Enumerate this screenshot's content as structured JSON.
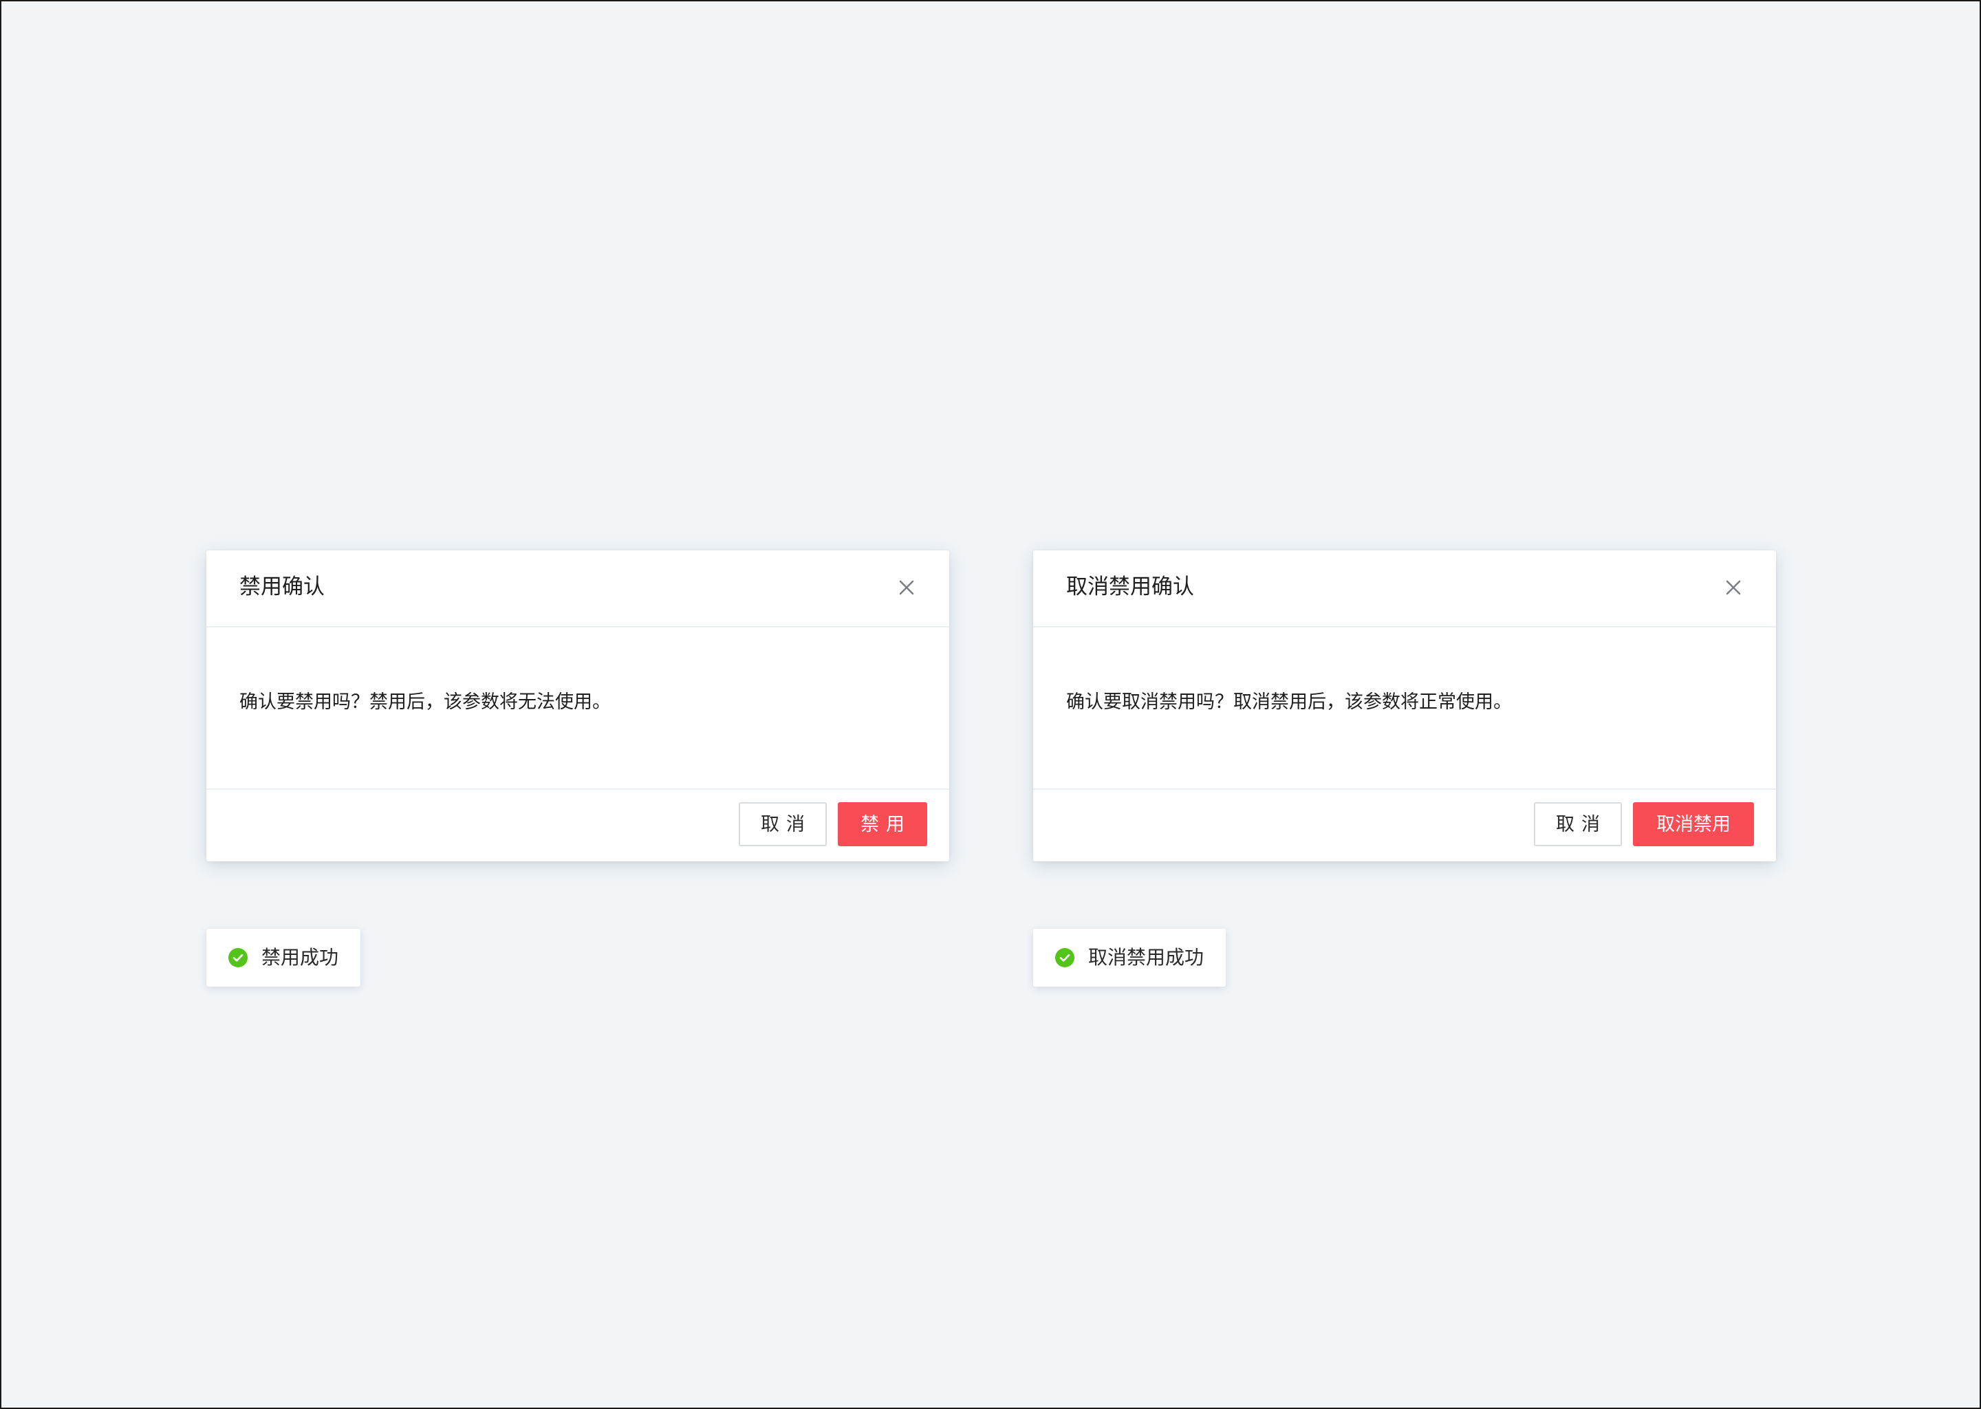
{
  "colors": {
    "page_background": "#f1f5f8",
    "danger": "#f94d56",
    "success": "#52c41a",
    "border": "#d7dbe0"
  },
  "disable_dialog": {
    "title": "禁用确认",
    "close_icon": "close-icon",
    "message": "确认要禁用吗？禁用后，该参数将无法使用。",
    "cancel_label": "取消",
    "confirm_label": "禁用"
  },
  "enable_dialog": {
    "title": "取消禁用确认",
    "close_icon": "close-icon",
    "message": "确认要取消禁用吗？取消禁用后，该参数将正常使用。",
    "cancel_label": "取消",
    "confirm_label": "取消禁用"
  },
  "disable_toast": {
    "icon": "check-circle-icon",
    "text": "禁用成功"
  },
  "enable_toast": {
    "icon": "check-circle-icon",
    "text": "取消禁用成功"
  }
}
